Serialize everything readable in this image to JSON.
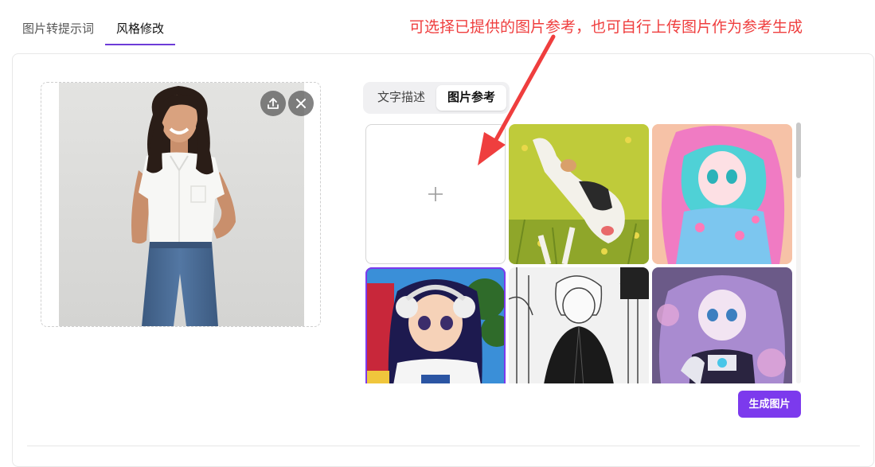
{
  "tabs": [
    {
      "label": "图片转提示词",
      "active": false
    },
    {
      "label": "风格修改",
      "active": true
    }
  ],
  "source": {
    "upload_icon": "upload-icon",
    "close_icon": "close-icon"
  },
  "mode_toggle": {
    "options": [
      "文字描述",
      "图片参考"
    ],
    "selected": "图片参考"
  },
  "reference_grid": {
    "add_icon": "plus-icon",
    "items": [
      {
        "name": "add-reference",
        "selected": false
      },
      {
        "name": "reference-dog-painting",
        "selected": false
      },
      {
        "name": "reference-pastel-anime-girl",
        "selected": false
      },
      {
        "name": "reference-retro-anime-headphones",
        "selected": true
      },
      {
        "name": "reference-manga-sketch-man",
        "selected": false
      },
      {
        "name": "reference-pixel-art-cyborg-girl",
        "selected": false
      }
    ]
  },
  "actions": {
    "generate_label": "生成图片"
  },
  "annotation": {
    "text": "可选择已提供的图片参考，也可自行上传图片作为参考生成"
  },
  "colors": {
    "accent": "#7c3aed",
    "annotation": "#ef3e3e"
  }
}
